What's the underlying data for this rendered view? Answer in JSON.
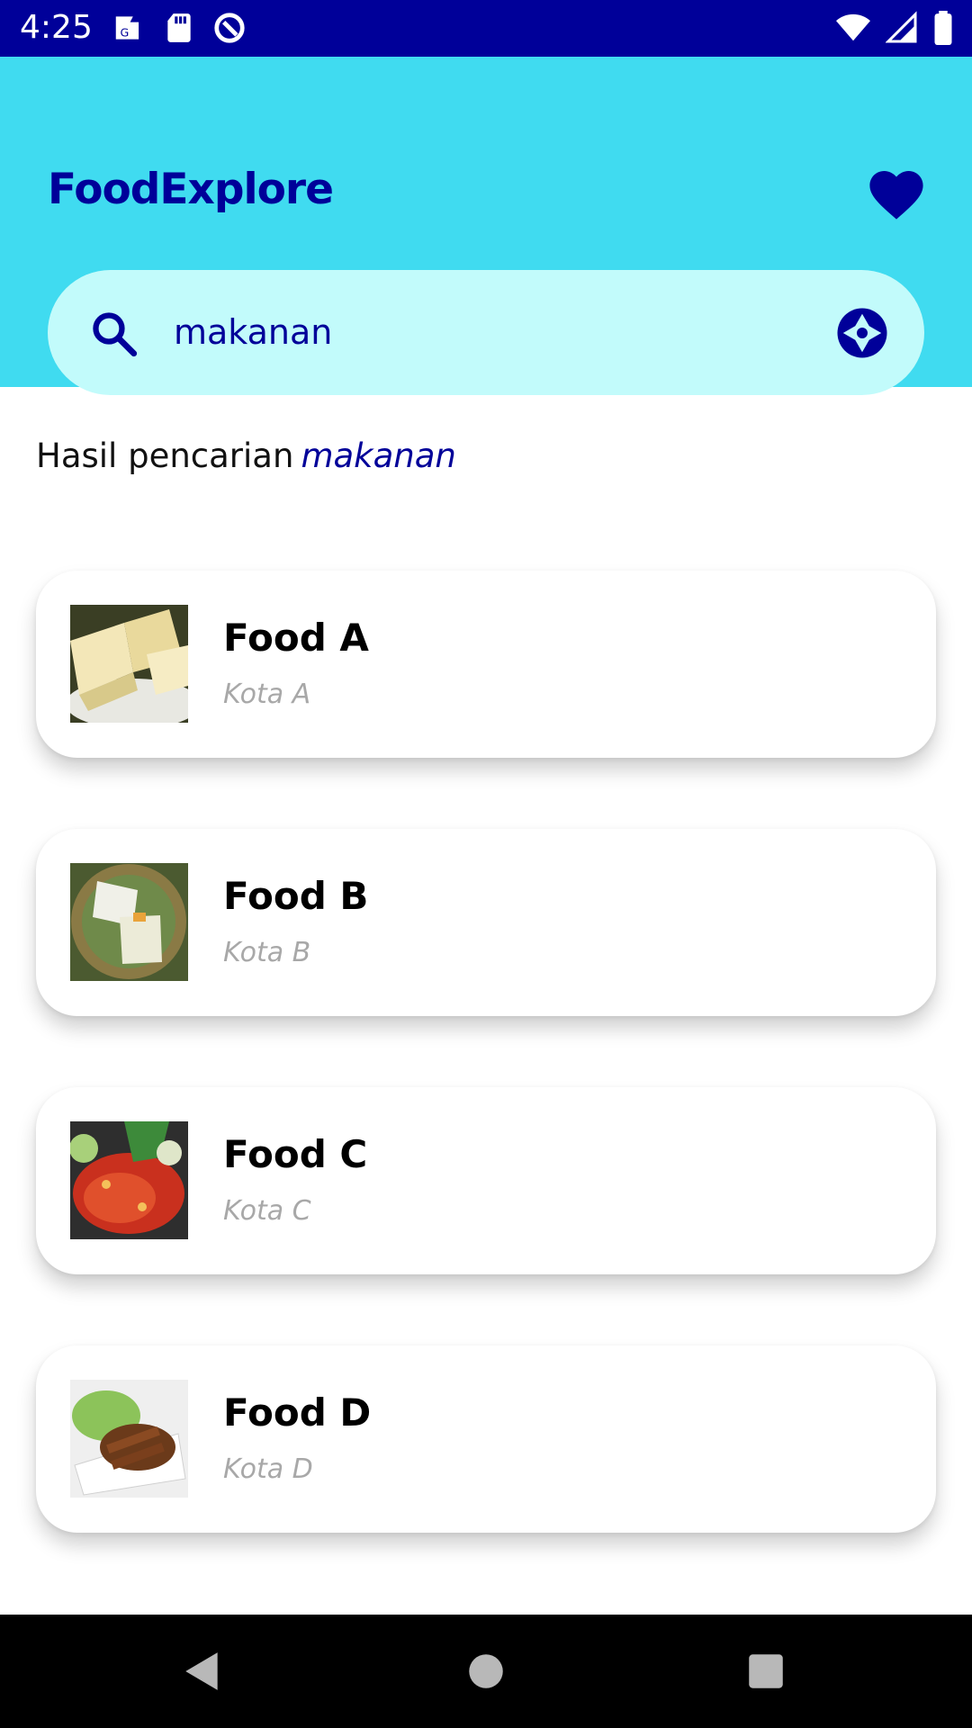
{
  "status_bar": {
    "time": "4:25",
    "left_icons": [
      "maps-notification-icon",
      "sd-card-icon",
      "no-sync-icon"
    ],
    "right_icons": [
      "wifi-icon",
      "signal-icon",
      "battery-icon"
    ]
  },
  "header": {
    "title": "FoodExplore",
    "favorite_icon": "heart-icon"
  },
  "search": {
    "value": "makanan",
    "placeholder": "",
    "camera_icon": "camera-aperture-icon"
  },
  "results": {
    "label": "Hasil pencarian",
    "query": "makanan",
    "items": [
      {
        "name": "Food A",
        "city": "Kota A"
      },
      {
        "name": "Food B",
        "city": "Kota B"
      },
      {
        "name": "Food C",
        "city": "Kota C"
      },
      {
        "name": "Food D",
        "city": "Kota D"
      }
    ]
  },
  "nav": {
    "back_icon": "back-triangle-icon",
    "home_icon": "home-circle-icon",
    "recents_icon": "recents-square-icon"
  },
  "colors": {
    "status_bar": "#000099",
    "header": "#40dbf0",
    "search_bg": "#c2fbfb",
    "accent": "#000099",
    "secondary_text": "#a8a8a8"
  }
}
